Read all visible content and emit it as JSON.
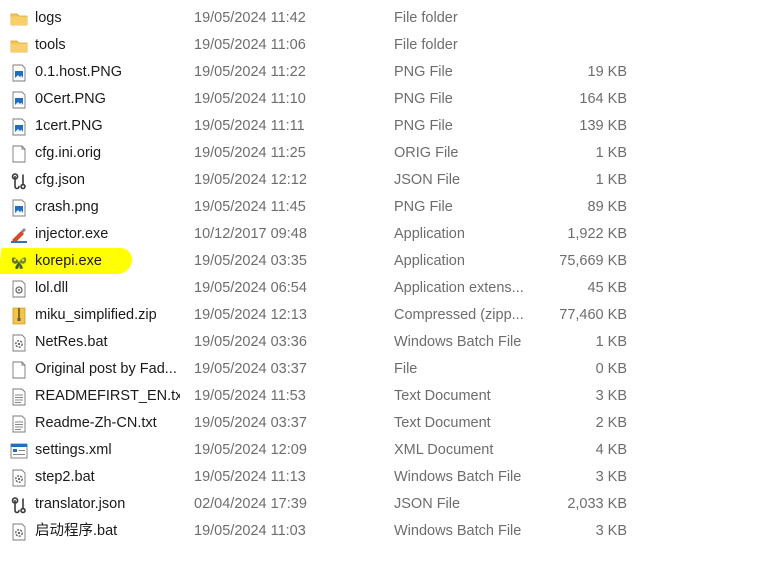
{
  "files": [
    {
      "name": "logs",
      "modified": "19/05/2024 11:42",
      "type": "File folder",
      "size": "",
      "icon": "folder-icon"
    },
    {
      "name": "tools",
      "modified": "19/05/2024 11:06",
      "type": "File folder",
      "size": "",
      "icon": "folder-icon"
    },
    {
      "name": "0.1.host.PNG",
      "modified": "19/05/2024 11:22",
      "type": "PNG File",
      "size": "19 KB",
      "icon": "image-file-icon"
    },
    {
      "name": "0Cert.PNG",
      "modified": "19/05/2024 11:10",
      "type": "PNG File",
      "size": "164 KB",
      "icon": "image-file-icon"
    },
    {
      "name": "1cert.PNG",
      "modified": "19/05/2024 11:11",
      "type": "PNG File",
      "size": "139 KB",
      "icon": "image-file-icon"
    },
    {
      "name": "cfg.ini.orig",
      "modified": "19/05/2024 11:25",
      "type": "ORIG File",
      "size": "1 KB",
      "icon": "blank-file-icon"
    },
    {
      "name": "cfg.json",
      "modified": "19/05/2024 12:12",
      "type": "JSON File",
      "size": "1 KB",
      "icon": "json-file-icon"
    },
    {
      "name": "crash.png",
      "modified": "19/05/2024 11:45",
      "type": "PNG File",
      "size": "89 KB",
      "icon": "image-file-icon"
    },
    {
      "name": "injector.exe",
      "modified": "10/12/2017 09:48",
      "type": "Application",
      "size": "1,922 KB",
      "icon": "injector-app-icon"
    },
    {
      "name": "korepi.exe",
      "modified": "19/05/2024 03:35",
      "type": "Application",
      "size": "75,669 KB",
      "icon": "korepi-app-icon",
      "highlighted": true
    },
    {
      "name": "lol.dll",
      "modified": "19/05/2024 06:54",
      "type": "Application extens...",
      "size": "45 KB",
      "icon": "dll-file-icon"
    },
    {
      "name": "miku_simplified.zip",
      "modified": "19/05/2024 12:13",
      "type": "Compressed (zipp...",
      "size": "77,460 KB",
      "icon": "zip-file-icon"
    },
    {
      "name": "NetRes.bat",
      "modified": "19/05/2024 03:36",
      "type": "Windows Batch File",
      "size": "1 KB",
      "icon": "batch-file-icon"
    },
    {
      "name": "Original post by Fad...",
      "modified": "19/05/2024 03:37",
      "type": "File",
      "size": "0 KB",
      "icon": "blank-file-icon"
    },
    {
      "name": "READMEFIRST_EN.txt",
      "modified": "19/05/2024 11:53",
      "type": "Text Document",
      "size": "3 KB",
      "icon": "text-file-icon"
    },
    {
      "name": "Readme-Zh-CN.txt",
      "modified": "19/05/2024 03:37",
      "type": "Text Document",
      "size": "2 KB",
      "icon": "text-file-icon"
    },
    {
      "name": "settings.xml",
      "modified": "19/05/2024 12:09",
      "type": "XML Document",
      "size": "4 KB",
      "icon": "xml-file-icon"
    },
    {
      "name": "step2.bat",
      "modified": "19/05/2024 11:13",
      "type": "Windows Batch File",
      "size": "3 KB",
      "icon": "batch-file-icon"
    },
    {
      "name": "translator.json",
      "modified": "02/04/2024 17:39",
      "type": "JSON File",
      "size": "2,033 KB",
      "icon": "json-file-icon"
    },
    {
      "name": "启动程序.bat",
      "modified": "19/05/2024 11:03",
      "type": "Windows Batch File",
      "size": "3 KB",
      "icon": "batch-file-icon"
    }
  ],
  "colors": {
    "highlight": "#ffff00",
    "text": "#1a1a1a",
    "secondary_text": "#6d6d6d",
    "folder": "#f3c449",
    "image_accent": "#1e6fc1"
  }
}
